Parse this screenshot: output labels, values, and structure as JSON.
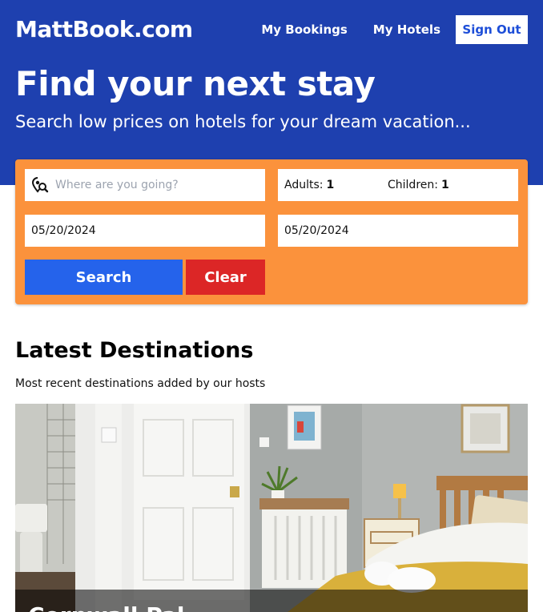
{
  "header": {
    "logo": "MattBook.com",
    "nav": {
      "bookings": "My Bookings",
      "hotels": "My Hotels",
      "signout": "Sign Out"
    }
  },
  "hero": {
    "title": "Find your next stay",
    "subtitle": "Search low prices on hotels for your dream vacation..."
  },
  "search": {
    "destination_placeholder": "Where are you going?",
    "adults_label": "Adults:",
    "adults_value": "1",
    "children_label": "Children:",
    "children_value": "1",
    "check_in": "05/20/2024",
    "check_out": "05/20/2024",
    "search_label": "Search",
    "clear_label": "Clear"
  },
  "latest": {
    "title": "Latest Destinations",
    "subtitle": "Most recent destinations added by our hosts",
    "card_caption": "Cornwall Pal..."
  },
  "colors": {
    "header": "#1e40af",
    "search_panel": "#fb923c",
    "search_button": "#2563eb",
    "clear_button": "#dc2626"
  }
}
